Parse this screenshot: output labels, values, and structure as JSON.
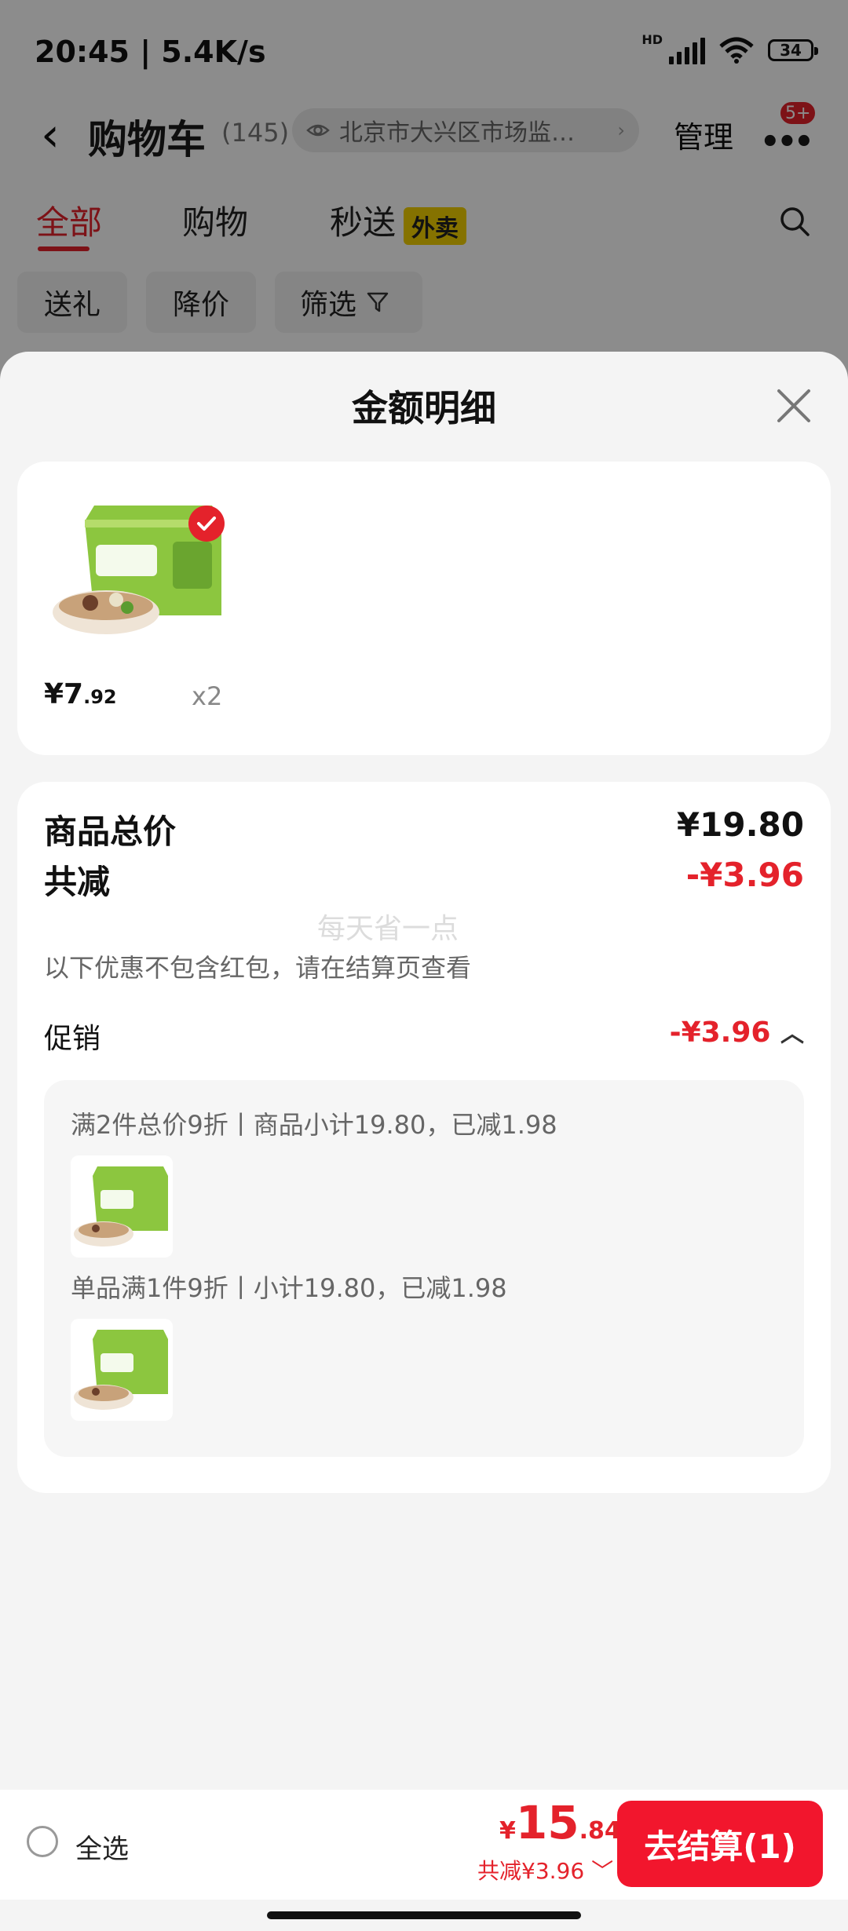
{
  "status_bar": {
    "time": "20:45 | 5.4K/s",
    "battery": "34"
  },
  "header": {
    "title": "购物车",
    "count": "(145)",
    "location": "北京市大兴区市场监…",
    "manage": "管理",
    "more_badge": "5+"
  },
  "tabs": [
    {
      "label": "全部"
    },
    {
      "label": "购物"
    },
    {
      "label": "秒送"
    }
  ],
  "tab_badge": "外卖",
  "chips": [
    {
      "label": "送礼"
    },
    {
      "label": "降价"
    },
    {
      "label": "筛选"
    }
  ],
  "sheet": {
    "title": "金额明细",
    "product": {
      "price_int": "¥7",
      "price_dec": ".92",
      "qty": "x2"
    },
    "total_label": "商品总价",
    "total_value": "¥19.80",
    "discount_label": "共减",
    "discount_value": "-¥3.96",
    "watermark": "每天省一点",
    "note": "以下优惠不包含红包，请在结算页查看",
    "promo_label": "促销",
    "promo_value": "-¥3.96",
    "promos": [
      {
        "text": "满2件总价9折丨商品小计19.80，已减1.98"
      },
      {
        "text": "单品满1件9折丨小计19.80，已减1.98"
      }
    ]
  },
  "bottom_bar": {
    "select_all": "全选",
    "currency": "¥",
    "total_int": "15",
    "total_dec": ".84",
    "saved": "共减¥3.96",
    "checkout": "去结算(1)"
  },
  "colors": {
    "accent": "#e4222b",
    "checkout": "#f2162d",
    "tab_badge": "#f3cf00"
  }
}
